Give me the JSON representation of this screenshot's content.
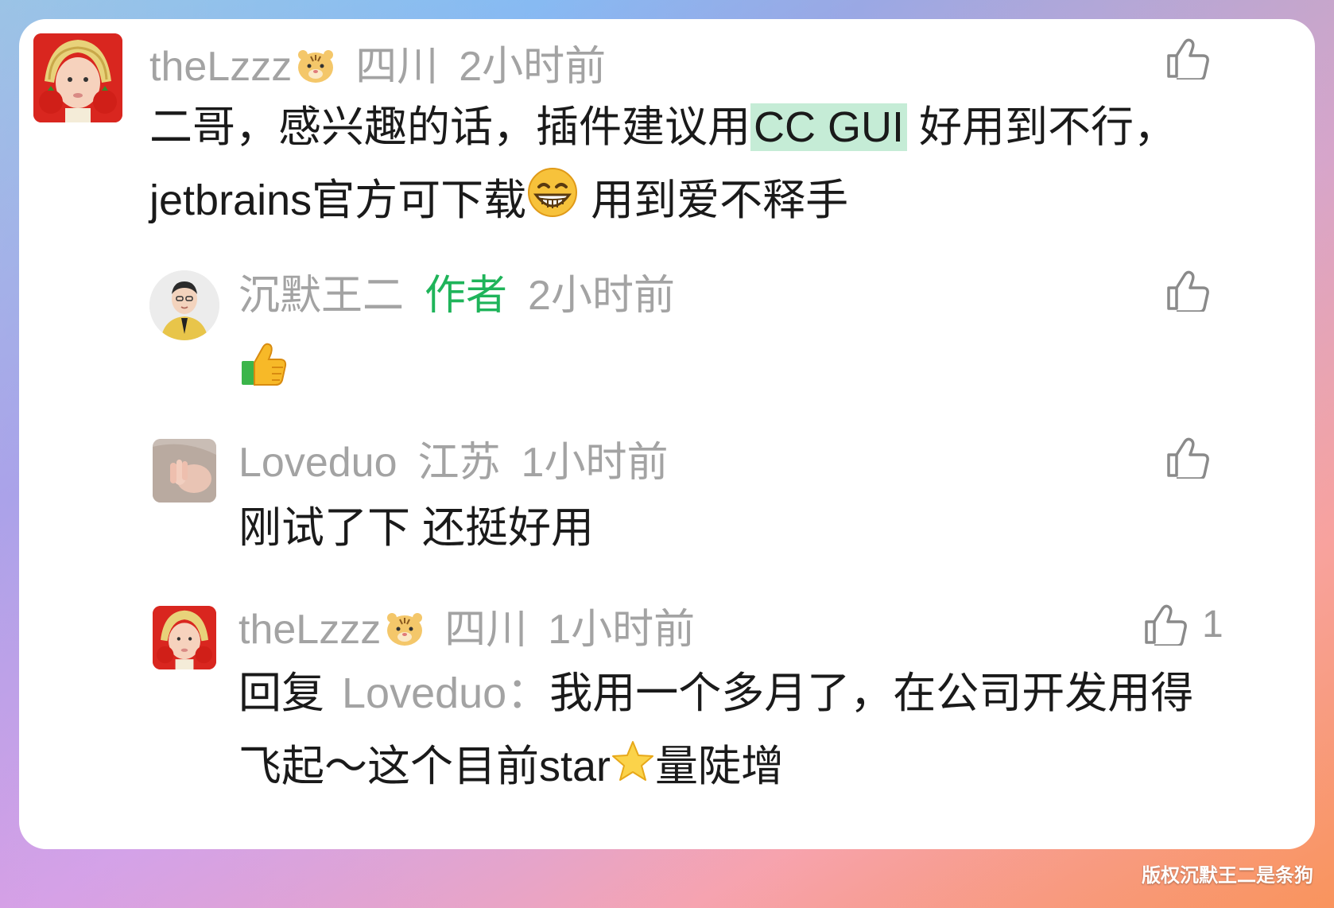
{
  "comments": [
    {
      "username": "theLzzz",
      "username_emoji": "tiger-face",
      "location": "四川",
      "time": "2小时前",
      "text_before": "二哥，感兴趣的话，插件建议用",
      "highlight": "CC GUI",
      "text_after": " 好用到不行，",
      "line2_before": "jetbrains官方可下载",
      "line2_emoji": "grinning-face-emoji",
      "line2_after": " 用到爱不释手",
      "likes": ""
    },
    {
      "username": "沉默王二",
      "author_tag": "作者",
      "time": "2小时前",
      "body_emoji": "thumbs-up-emoji",
      "likes": ""
    },
    {
      "username": "Loveduo",
      "location": "江苏",
      "time": "1小时前",
      "text": "刚试了下 还挺好用",
      "likes": ""
    },
    {
      "username": "theLzzz",
      "username_emoji": "tiger-face",
      "location": "四川",
      "time": "1小时前",
      "reply_prefix": "回复",
      "reply_to": "Loveduo",
      "reply_colon": "：",
      "text_line1": "我用一个多月了，在公司开发用得",
      "text_line2_before": "飞起～这个目前star",
      "text_line2_emoji": "star-emoji",
      "text_line2_after": "量陡增",
      "likes": "1"
    }
  ],
  "watermark": "版权沉默王二是条狗",
  "colors": {
    "author_tag": "#1fb45a",
    "highlight": "#c5ecd6",
    "meta": "#a3a3a3",
    "text": "#1a1a1a"
  }
}
